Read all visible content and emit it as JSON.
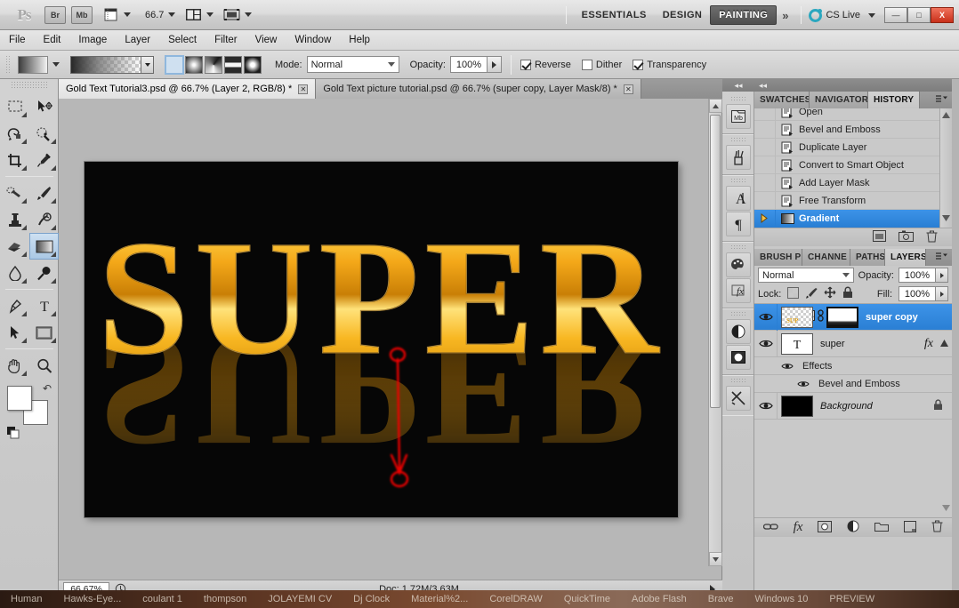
{
  "app": {
    "logo": "Ps",
    "launch_buttons": [
      {
        "name": "bridge",
        "label": "Br"
      },
      {
        "name": "mini-bridge",
        "label": "Mb"
      }
    ],
    "zoom_level": "66.7",
    "workspaces": [
      {
        "label": "ESSENTIALS",
        "active": false
      },
      {
        "label": "DESIGN",
        "active": false
      },
      {
        "label": "PAINTING",
        "active": true
      }
    ],
    "more_workspaces": "»",
    "cs_live": "CS Live",
    "window_buttons": {
      "minimize": "—",
      "restore": "□",
      "close": "X"
    }
  },
  "menubar": {
    "items": [
      "File",
      "Edit",
      "Image",
      "Layer",
      "Select",
      "Filter",
      "View",
      "Window",
      "Help"
    ]
  },
  "options": {
    "mode_label": "Mode:",
    "mode_value": "Normal",
    "opacity_label": "Opacity:",
    "opacity_value": "100%",
    "checkboxes": [
      {
        "label": "Reverse",
        "checked": true
      },
      {
        "label": "Dither",
        "checked": false
      },
      {
        "label": "Transparency",
        "checked": true
      }
    ],
    "gradient_types": [
      "linear-gradient",
      "radial-gradient",
      "angle-gradient",
      "reflected-gradient",
      "diamond-gradient"
    ],
    "selected_gradient_type": 0
  },
  "tabs": [
    {
      "title": "Gold Text Tutorial3.psd @ 66.7% (Layer 2, RGB/8) *",
      "active": true,
      "close": "✕"
    },
    {
      "title": "Gold Text picture tutorial.psd @ 66.7% (super copy, Layer Mask/8) *",
      "active": false,
      "close": "✕"
    }
  ],
  "toolbox": {
    "tools": [
      {
        "name": "rectangular-marquee-tool",
        "selected": false
      },
      {
        "name": "move-tool",
        "selected": false
      },
      {
        "name": "lasso-tool",
        "selected": false
      },
      {
        "name": "quick-selection-tool",
        "selected": false
      },
      {
        "name": "crop-tool",
        "selected": false
      },
      {
        "name": "eyedropper-tool",
        "selected": false
      },
      {
        "name": "spot-healing-brush-tool",
        "selected": false
      },
      {
        "name": "brush-tool",
        "selected": false
      },
      {
        "name": "clone-stamp-tool",
        "selected": false
      },
      {
        "name": "history-brush-tool",
        "selected": false
      },
      {
        "name": "eraser-tool",
        "selected": false
      },
      {
        "name": "gradient-tool",
        "selected": true
      },
      {
        "name": "blur-tool",
        "selected": false
      },
      {
        "name": "dodge-tool",
        "selected": false
      },
      {
        "name": "pen-tool",
        "selected": false
      },
      {
        "name": "horizontal-type-tool",
        "selected": false
      },
      {
        "name": "path-selection-tool",
        "selected": false
      },
      {
        "name": "rectangle-tool",
        "selected": false
      },
      {
        "name": "hand-tool",
        "selected": false
      },
      {
        "name": "zoom-tool",
        "selected": false
      }
    ],
    "foreground_color": "#ffffff",
    "background_color": "#ffffff"
  },
  "canvas": {
    "text": "SUPER",
    "background_color": "#060606",
    "gold_highlight": "#ffd54a",
    "gold_mid": "#f0a81e",
    "gold_dark": "#8a5a05",
    "annotation_color": "#ee0000",
    "annotation_shape": "vertical-arrow-with-circles"
  },
  "status": {
    "zoom": "66.67%",
    "doc": "Doc: 1.72M/3.63M"
  },
  "icondock": {
    "groups": [
      [
        "mini-bridge-icon"
      ],
      [
        "brush-presets-icon"
      ],
      [
        "character-icon",
        "paragraph-icon"
      ],
      [
        "color-palette-icon",
        "styles-fx-icon"
      ],
      [
        "adjustments-icon",
        "masks-icon"
      ],
      [
        "tool-presets-icon"
      ]
    ]
  },
  "history_panel": {
    "tabs": [
      {
        "label": "SWATCHES",
        "active": false
      },
      {
        "label": "NAVIGATOR",
        "active": false
      },
      {
        "label": "HISTORY",
        "active": true
      }
    ],
    "states": [
      {
        "label": "Open",
        "selected": false
      },
      {
        "label": "Bevel and Emboss",
        "selected": false
      },
      {
        "label": "Duplicate Layer",
        "selected": false
      },
      {
        "label": "Convert to Smart Object",
        "selected": false
      },
      {
        "label": "Add Layer Mask",
        "selected": false
      },
      {
        "label": "Free Transform",
        "selected": false
      },
      {
        "label": "Gradient",
        "selected": true
      }
    ],
    "footer_buttons": [
      "create-document-from-state-icon",
      "create-new-snapshot-icon",
      "delete-state-icon"
    ]
  },
  "layers_panel": {
    "tabs": [
      {
        "label": "BRUSH P",
        "active": false
      },
      {
        "label": "CHANNE",
        "active": false
      },
      {
        "label": "PATHS",
        "active": false
      },
      {
        "label": "LAYERS",
        "active": true
      }
    ],
    "blend_mode": "Normal",
    "opacity_label": "Opacity:",
    "opacity_value": "100%",
    "lock_label": "Lock:",
    "lock_icons": [
      "lock-transparent-pixels-icon",
      "lock-image-pixels-icon",
      "lock-position-icon",
      "lock-all-icon"
    ],
    "fill_label": "Fill:",
    "fill_value": "100%",
    "layers": [
      {
        "name": "super copy",
        "selected": true,
        "visible": true,
        "kind": "masked-smart-object",
        "italic": false,
        "has_fx": false,
        "locked": false
      },
      {
        "name": "super",
        "selected": false,
        "visible": true,
        "kind": "type",
        "italic": false,
        "has_fx": true,
        "locked": false
      },
      {
        "name": "Effects",
        "selected": false,
        "visible": true,
        "kind": "effects-group",
        "italic": false,
        "has_fx": false,
        "locked": false
      },
      {
        "name": "Bevel and Emboss",
        "selected": false,
        "visible": true,
        "kind": "effect",
        "italic": false,
        "has_fx": false,
        "locked": false
      },
      {
        "name": "Background",
        "selected": false,
        "visible": true,
        "kind": "raster",
        "italic": true,
        "has_fx": false,
        "locked": true
      }
    ],
    "footer_buttons": [
      "link-layers-icon",
      "add-layer-style-icon",
      "add-layer-mask-icon",
      "new-adjustment-layer-icon",
      "new-group-icon",
      "new-layer-icon",
      "delete-layer-icon"
    ]
  },
  "taskbar": {
    "items": [
      "Human",
      "Hawks-Eye...",
      "coulant 1",
      "thompson",
      "JOLAYEMI CV",
      "Dj Clock",
      "Material%2...",
      "CorelDRAW",
      "QuickTime",
      "Adobe Flash",
      "Brave",
      "Windows 10",
      "PREVIEW"
    ]
  }
}
